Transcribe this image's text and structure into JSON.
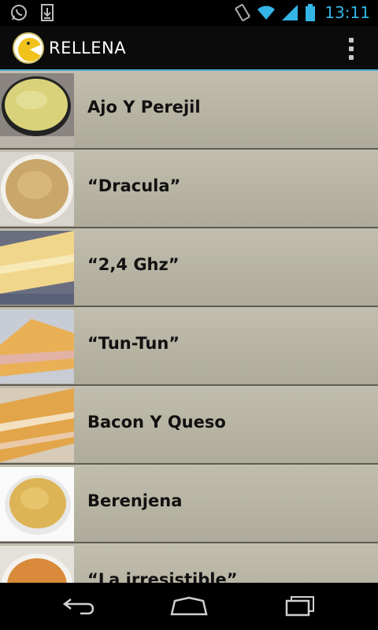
{
  "status_bar": {
    "time": "13:11",
    "icons": [
      "whatsapp-icon",
      "download-icon",
      "vibrate-icon",
      "wifi-icon",
      "signal-icon",
      "battery-icon"
    ]
  },
  "action_bar": {
    "title": "RELLENA",
    "overflow_icon": "overflow-menu-icon"
  },
  "list": {
    "items": [
      {
        "label": "Ajo Y Perejil"
      },
      {
        "label": "“Dracula”"
      },
      {
        "label": "“2,4 Ghz”"
      },
      {
        "label": "“Tun-Tun”"
      },
      {
        "label": "Bacon Y Queso"
      },
      {
        "label": "Berenjena"
      },
      {
        "label": "“La irresistible”"
      }
    ]
  },
  "nav_bar": {
    "icons": [
      "back-icon",
      "home-icon",
      "recent-apps-icon"
    ]
  },
  "colors": {
    "accent": "#33b5e5",
    "list_bg": "#b4b1a0",
    "divider": "#5f5c52"
  }
}
